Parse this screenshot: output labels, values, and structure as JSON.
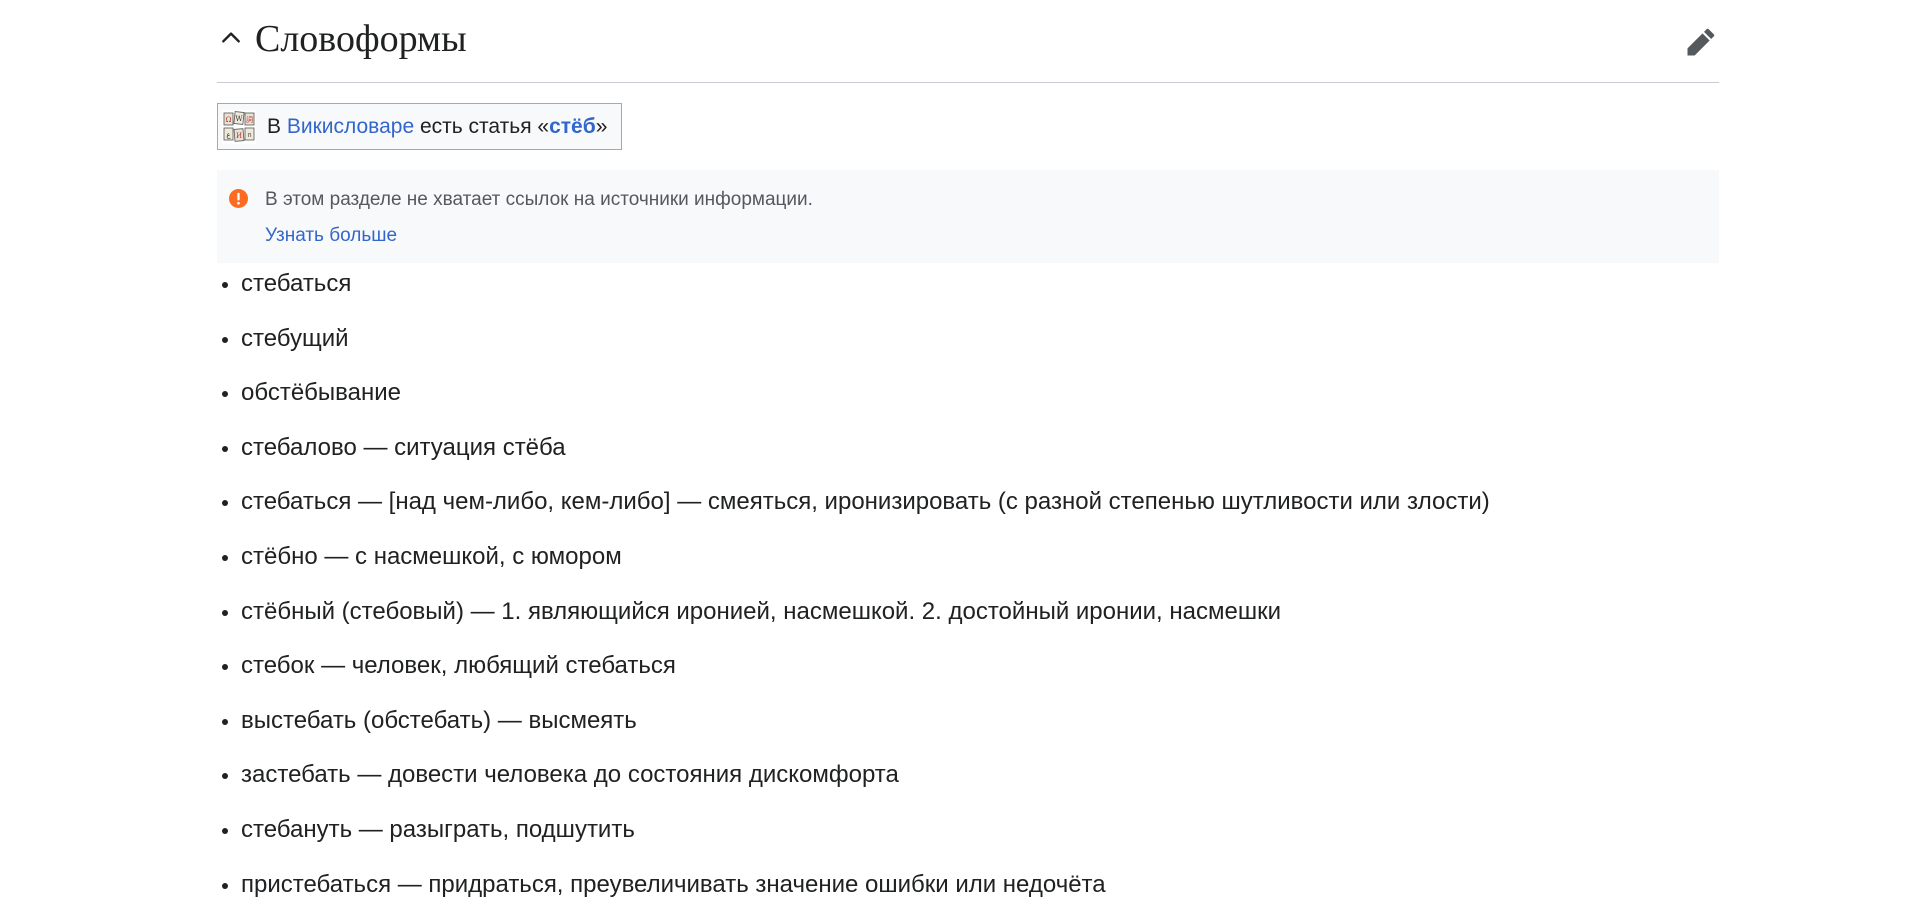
{
  "section": {
    "title": "Словоформы",
    "collapse_icon": "chevron-up-icon",
    "edit_icon": "pencil-icon"
  },
  "wiktionary": {
    "prefix": "В ",
    "link_label": "Викисловаре",
    "middle": " есть статья «",
    "article_label": "стёб",
    "suffix": "»",
    "logo_icon": "wiktionary-logo-icon"
  },
  "notice": {
    "icon": "exclamation-circle-icon",
    "text": "В этом разделе не хватает ссылок на источники информации.",
    "more_label": "Узнать больше",
    "icon_color": "#fc6b21"
  },
  "word_forms": [
    "стебаться",
    "стебущий",
    "обстёбывание",
    "стебалово — ситуация стёба",
    "стебаться — [над чем-либо, кем-либо] — смеяться, иронизировать (с разной степенью шутливости или злости)",
    "стёбно — с насмешкой, с юмором",
    "стёбный (стебовый) — 1. являющийся иронией, насмешкой. 2. достойный иронии, насмешки",
    "стебок — человек, любящий стебаться",
    "выстебать (обстебать) — высмеять",
    "застебать — довести человека до состояния дискомфорта",
    "стебануть — разыграть, подшутить",
    "пристебаться — придраться, преувеличивать значение ошибки или недочёта"
  ],
  "colors": {
    "link": "#3366cc",
    "text": "#202122",
    "notice_bg": "#f8f9fa"
  }
}
